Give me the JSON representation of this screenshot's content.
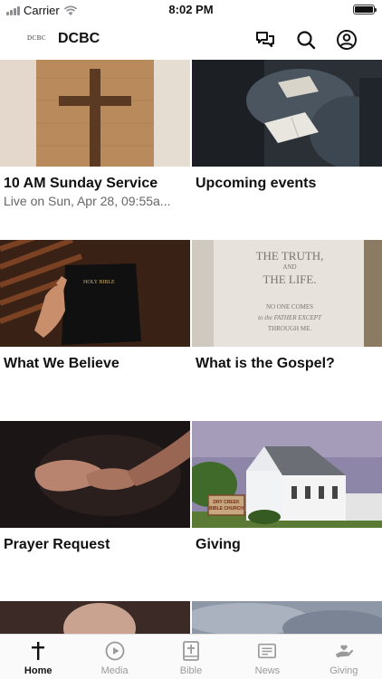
{
  "status_bar": {
    "carrier": "Carrier",
    "time": "8:02 PM"
  },
  "header": {
    "logo_text": "DCBC",
    "title": "DCBC",
    "icons": [
      "chat-icon",
      "search-icon",
      "profile-icon"
    ]
  },
  "cards": [
    {
      "title": "10 AM Sunday Service",
      "subtitle": "Live on Sun, Apr 28, 09:55a...",
      "image": "wooden-cross-photo"
    },
    {
      "title": "Upcoming events",
      "subtitle": "",
      "image": "people-reading-bibles-photo"
    },
    {
      "title": "What We Believe",
      "subtitle": "",
      "image": "hand-on-holy-bible-photo",
      "image_text": "HOLY BIBLE"
    },
    {
      "title": "What is the Gospel?",
      "subtitle": "",
      "image": "bible-page-photo",
      "image_text": [
        "THE TRUTH,",
        "AND",
        "THE LIFE.",
        "NO ONE COMES",
        "to the FATHER EXCEPT",
        "THROUGH ME."
      ]
    },
    {
      "title": "Prayer Request",
      "subtitle": "",
      "image": "open-hands-photo"
    },
    {
      "title": "Giving",
      "subtitle": "",
      "image": "white-church-photo",
      "image_text": [
        "DRY CREEK",
        "BIBLE CHURCH"
      ]
    },
    {
      "title": "",
      "subtitle": "",
      "image": "partial-photo-hands"
    },
    {
      "title": "",
      "subtitle": "",
      "image": "partial-photo-sky"
    }
  ],
  "tabs": [
    {
      "label": "Home",
      "icon": "cross-icon",
      "active": true
    },
    {
      "label": "Media",
      "icon": "play-circle-icon",
      "active": false
    },
    {
      "label": "Bible",
      "icon": "bible-icon",
      "active": false
    },
    {
      "label": "News",
      "icon": "news-icon",
      "active": false
    },
    {
      "label": "Giving",
      "icon": "giving-hand-icon",
      "active": false
    }
  ],
  "colors": {
    "active_tab": "#111111",
    "inactive_tab": "#9a9a9a",
    "subtitle": "#666666"
  }
}
